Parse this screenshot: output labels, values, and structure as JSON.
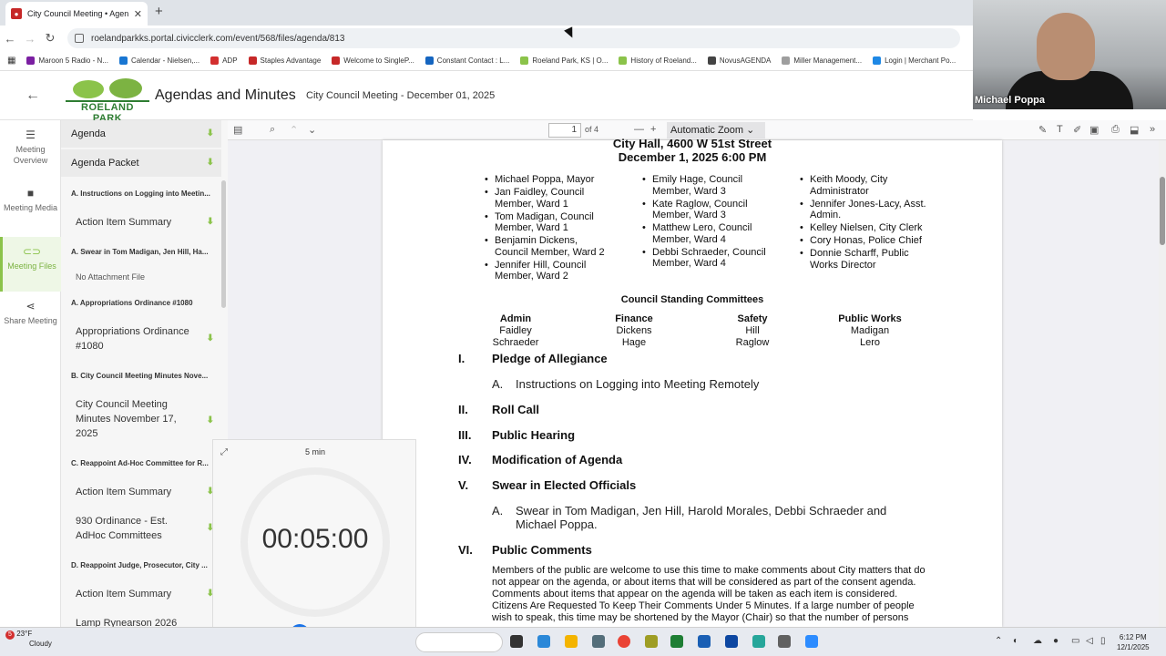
{
  "browser": {
    "tab_title": "City Council Meeting • Agenda",
    "new_tab": "+",
    "url": "roelandparkks.portal.civicclerk.com/event/568/files/agenda/813",
    "bookmarks": [
      "Maroon 5 Radio - N...",
      "Calendar - Nielsen,...",
      "ADP",
      "Staples Advantage",
      "Welcome to SingleP...",
      "Constant Contact : L...",
      "Roeland Park, KS | O...",
      "History of Roeland...",
      "NovusAGENDA",
      "Miller Management...",
      "Login | Merchant Po..."
    ]
  },
  "video": {
    "participant_name": "Michael Poppa"
  },
  "app": {
    "logo_text": "ROELAND PARK",
    "title": "Agendas and Minutes",
    "meeting": "City Council Meeting - December 01, 2025"
  },
  "rail": [
    {
      "label": "Meeting Overview",
      "icon": "list-icon"
    },
    {
      "label": "Meeting Media",
      "icon": "video-icon"
    },
    {
      "label": "Meeting Files",
      "icon": "paperclip-icon"
    },
    {
      "label": "Share Meeting",
      "icon": "share-icon"
    }
  ],
  "files": {
    "agenda": "Agenda",
    "packet": "Agenda Packet",
    "items": [
      {
        "type": "sec",
        "label": "A. Instructions on Logging into Meetin..."
      },
      {
        "type": "att",
        "label": "Action Item Summary"
      },
      {
        "type": "sec",
        "label": "A. Swear in Tom Madigan, Jen Hill, Ha..."
      },
      {
        "type": "none",
        "label": "No Attachment File"
      },
      {
        "type": "sec",
        "label": "A. Appropriations Ordinance #1080"
      },
      {
        "type": "att",
        "label": "Appropriations Ordinance #1080"
      },
      {
        "type": "sec",
        "label": "B. City Council Meeting Minutes Nove..."
      },
      {
        "type": "att",
        "label": "City Council Meeting Minutes November 17, 2025"
      },
      {
        "type": "sec",
        "label": "C. Reappoint Ad-Hoc Committee for R..."
      },
      {
        "type": "att",
        "label": "Action Item Summary"
      },
      {
        "type": "att",
        "label": "930 Ordinance - Est. AdHoc Committees"
      },
      {
        "type": "sec",
        "label": "D. Reappoint Judge, Prosecutor, City ..."
      },
      {
        "type": "att",
        "label": "Action Item Summary"
      },
      {
        "type": "att",
        "label": "Lamp Rynearson 2026"
      }
    ]
  },
  "viewer": {
    "page": "1",
    "page_count": "of 4",
    "zoom": "Automatic Zoom"
  },
  "doc": {
    "location": "City Hall, 4600 W 51st Street",
    "date": "December 1, 2025 6:00 PM",
    "col1": [
      "Michael Poppa, Mayor",
      "Jan Faidley, Council Member, Ward 1",
      "Tom Madigan, Council Member, Ward 1",
      "Benjamin Dickens, Council Member, Ward 2",
      "Jennifer Hill, Council Member, Ward 2"
    ],
    "col2": [
      "Emily Hage, Council Member, Ward 3",
      "Kate Raglow, Council Member, Ward 3",
      "Matthew Lero, Council Member, Ward 4",
      "Debbi Schraeder, Council Member, Ward 4"
    ],
    "col3": [
      "Keith Moody, City Administrator",
      "Jennifer Jones-Lacy, Asst. Admin.",
      "Kelley Nielsen, City Clerk",
      "Cory Honas, Police Chief",
      "Donnie Scharff, Public Works Director"
    ],
    "committees_title": "Council Standing Committees",
    "committees": [
      {
        "name": "Admin",
        "m1": "Faidley",
        "m2": "Schraeder"
      },
      {
        "name": "Finance",
        "m1": "Dickens",
        "m2": "Hage"
      },
      {
        "name": "Safety",
        "m1": "Hill",
        "m2": "Raglow"
      },
      {
        "name": "Public Works",
        "m1": "Madigan",
        "m2": "Lero"
      }
    ],
    "s1n": "I.",
    "s1": "Pledge of Allegiance",
    "s1a_n": "A.",
    "s1a": "Instructions on Logging into Meeting Remotely",
    "s2n": "II.",
    "s2": "Roll Call",
    "s3n": "III.",
    "s3": "Public Hearing",
    "s4n": "IV.",
    "s4": "Modification of Agenda",
    "s5n": "V.",
    "s5": "Swear in Elected Officials",
    "s5a_n": "A.",
    "s5a": "Swear in Tom Madigan, Jen Hill, Harold Morales, Debbi Schraeder and Michael Poppa.",
    "s6n": "VI.",
    "s6": "Public Comments",
    "para": "Members of the public are welcome to use this time to make comments about City matters that do not appear on the agenda, or about items that will be considered as part of the consent agenda. Comments about items that appear on the agenda will be taken as each item is considered. Citizens Are Requested To Keep Their Comments Under 5 Minutes. If a large number of people wish to speak, this time may be shortened by the Mayor (Chair) so that the number of persons"
  },
  "timer": {
    "label": "5 min",
    "time": "00:05:00"
  },
  "taskbar": {
    "weather_badge": "5",
    "temp": "23°F",
    "condition": "Cloudy",
    "time": "6:12 PM",
    "date": "12/1/2025"
  }
}
